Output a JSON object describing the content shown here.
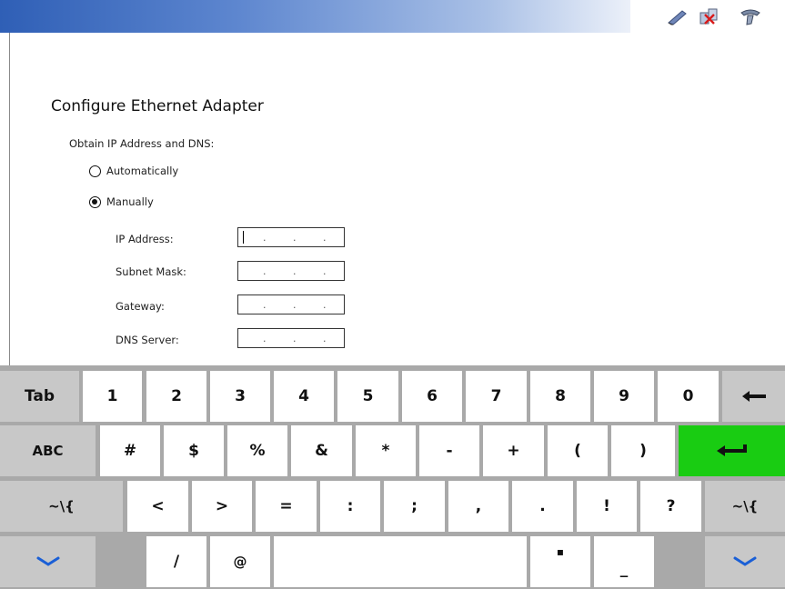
{
  "window": {
    "tray_icons": [
      "pen-icon",
      "network-disconnected-icon",
      "network-adapter-icon"
    ]
  },
  "form": {
    "title": "Configure Ethernet Adapter",
    "obtain_label": "Obtain IP Address and DNS:",
    "options": [
      {
        "label": "Automatically",
        "selected": false
      },
      {
        "label": "Manually",
        "selected": true
      }
    ],
    "fields": [
      {
        "label": "IP Address:",
        "value": ". . .",
        "focused": true
      },
      {
        "label": "Subnet Mask:",
        "value": ". . ."
      },
      {
        "label": "Gateway:",
        "value": ". . ."
      },
      {
        "label": "DNS Server:",
        "value": ". . ."
      }
    ]
  },
  "keyboard": {
    "row1": [
      "Tab",
      "1",
      "2",
      "3",
      "4",
      "5",
      "6",
      "7",
      "8",
      "9",
      "0",
      "backspace-icon"
    ],
    "row2": [
      "ABC",
      "#",
      "$",
      "%",
      "&",
      "*",
      "-",
      "+",
      "(",
      ")",
      "enter-icon"
    ],
    "row3": [
      "~\\{",
      "<",
      ">",
      "=",
      ":",
      ";",
      ",",
      ".",
      "!",
      "?",
      "~\\{"
    ],
    "row4": [
      "chevron-down-icon",
      "/",
      "@",
      "space",
      "▪",
      "_",
      "chevron-down-icon"
    ],
    "colors": {
      "background": "#a9a9a9",
      "key": "#ffffff",
      "modifier": "#c8c8c8",
      "enter": "#19cc12",
      "chevron": "#1a5fd6"
    }
  }
}
